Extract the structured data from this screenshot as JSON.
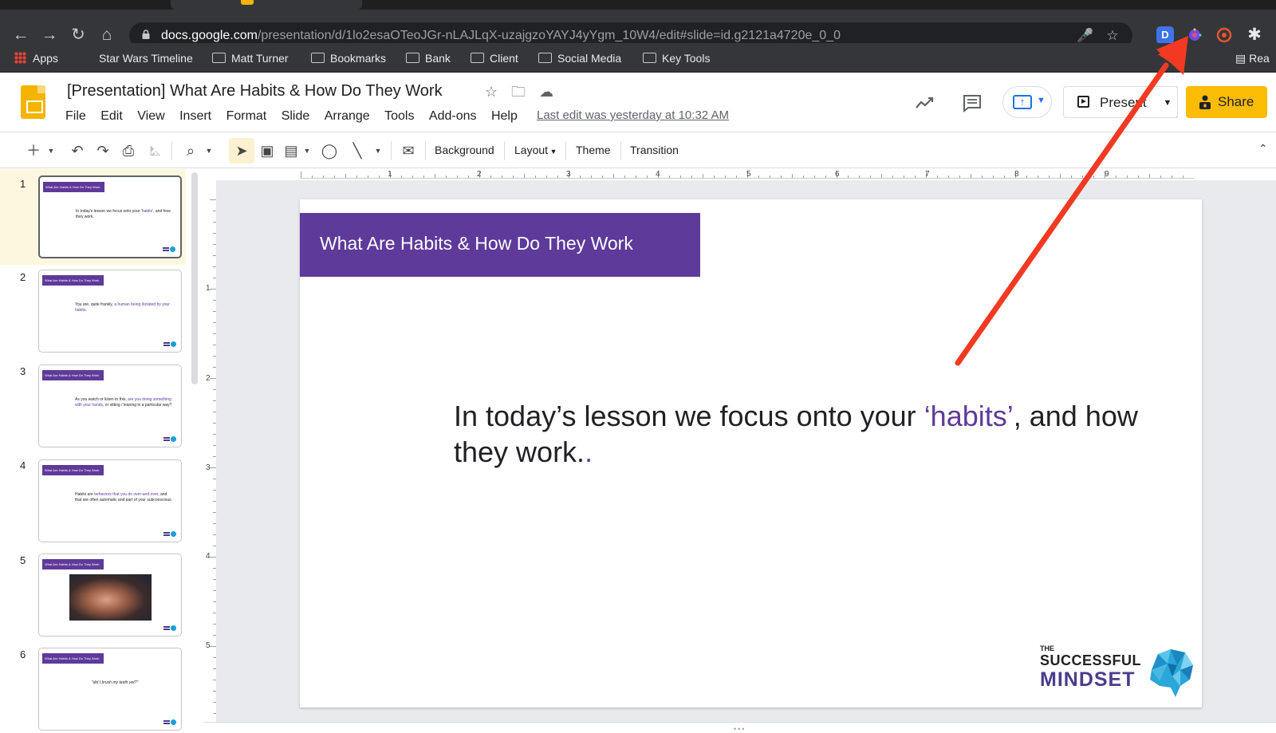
{
  "browser": {
    "url_host": "docs.google.com",
    "url_path": "/presentation/d/1lo2esaOTeoJGr-nLAJLqX-uzajgzoYAYJ4yYgm_10W4/edit#slide=id.g2121a4720e_0_0",
    "bookmarks": [
      "Apps",
      "Star Wars Timeline",
      "Matt Turner",
      "Bookmarks",
      "Bank",
      "Client",
      "Social Media",
      "Key Tools"
    ],
    "reading_list_label": "Rea",
    "extension_d_label": "D"
  },
  "doc": {
    "title": "[Presentation] What Are Habits & How Do They Work",
    "menu": [
      "File",
      "Edit",
      "View",
      "Insert",
      "Format",
      "Slide",
      "Arrange",
      "Tools",
      "Add-ons",
      "Help"
    ],
    "last_edit": "Last edit was yesterday at 10:32 AM",
    "present_label": "Present",
    "share_label": "Share"
  },
  "toolbar": {
    "background_label": "Background",
    "layout_label": "Layout",
    "theme_label": "Theme",
    "transition_label": "Transition"
  },
  "ruler": {
    "top_numbers": [
      "1",
      "2",
      "3",
      "4",
      "5",
      "6",
      "7",
      "8",
      "9"
    ],
    "left_numbers": [
      "1",
      "2",
      "3",
      "4",
      "5"
    ]
  },
  "filmstrip": {
    "slides": [
      {
        "num": "1",
        "title": "What Are Habits & How Do They Work",
        "text_a": "In today's lesson we focus onto your ",
        "text_hl": "'habits'",
        "text_b": ", and how they work."
      },
      {
        "num": "2",
        "title": "What Are Habits & How Do They Work",
        "text_a": "You are, quite frankly, ",
        "text_hl": "a human being dictated by your habits",
        "text_b": "."
      },
      {
        "num": "3",
        "title": "What Are Habits & How Do They Work",
        "text_a": "As you watch or listen to this, ",
        "text_hl": "are you doing something with your hands",
        "text_b": ", or sitting / leaning in a particular way?"
      },
      {
        "num": "4",
        "title": "What Are Habits & How Do They Work",
        "text_a": "Habits are ",
        "text_hl": "behaviors that you do over-and-over",
        "text_b": ", and that are often automatic and part of your subconscious."
      },
      {
        "num": "5",
        "title": "What Are Habits & How Do They Work"
      },
      {
        "num": "6",
        "title": "What Are Habits & How Do They Work",
        "quote": "\"did I brush my teeth yet?\""
      }
    ]
  },
  "slide": {
    "title": "What Are Habits & How Do They Work",
    "body_a": "In today’s lesson we focus onto your ",
    "body_hl": "‘habits’",
    "body_b": ", and how they work.",
    "body_dot": ".",
    "logo_the": "THE",
    "logo_successful": "SUCCESSFUL",
    "logo_mindset": "MINDSET"
  },
  "colors": {
    "accent_purple": "#5e3a9a",
    "share_yellow": "#fbbc04",
    "annotation_arrow": "#f23a22"
  }
}
